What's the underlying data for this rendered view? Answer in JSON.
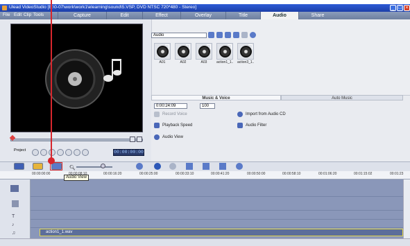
{
  "window": {
    "title": "Ulead VideoStudio [E:\\0-07\\work\\work1\\elearning\\sound\\5.VSP, DVD NTSC 720*480 - Stereo]"
  },
  "menu": {
    "items": [
      "File",
      "Edit",
      "Clip",
      "Tools"
    ],
    "steps": [
      "Capture",
      "Edit",
      "Effect",
      "Overlay",
      "Title",
      "Audio",
      "Share"
    ],
    "active_step": "Audio"
  },
  "library": {
    "category": "Audio",
    "clips": [
      {
        "label": "A01"
      },
      {
        "label": "A02"
      },
      {
        "label": "A03"
      },
      {
        "label": "action1_1..."
      },
      {
        "label": "action3_1..."
      }
    ]
  },
  "options": {
    "tabs": [
      "Music & Voice",
      "Auto Music"
    ],
    "active_tab": "Music & Voice",
    "duration": "0:00:24:09",
    "volume": "100",
    "record_voice": "Record Voice",
    "import_cd": "Import from Audio CD",
    "playback_speed": "Playback Speed",
    "audio_filter": "Audio Filter",
    "audio_view": "Audio View"
  },
  "preview": {
    "project_label": "Project",
    "timecode": "00:00:00:00"
  },
  "timeline": {
    "ruler_ticks": [
      "00:00:00:00",
      "00:00:08:10",
      "00:00:16:20",
      "00:00:25:00",
      "00:00:33:10",
      "00:00:41:20",
      "00:00:50:00",
      "00:00:58:10",
      "00:01:06:20",
      "00:01:15:02",
      "00:01:23"
    ],
    "tooltip": "Audio View",
    "audio_clip": "action1_1.wav"
  },
  "colors": {
    "annotation_red": "#d7262d",
    "title_blue": "#2e5bd6",
    "timeline_bg": "#8a97b9"
  }
}
